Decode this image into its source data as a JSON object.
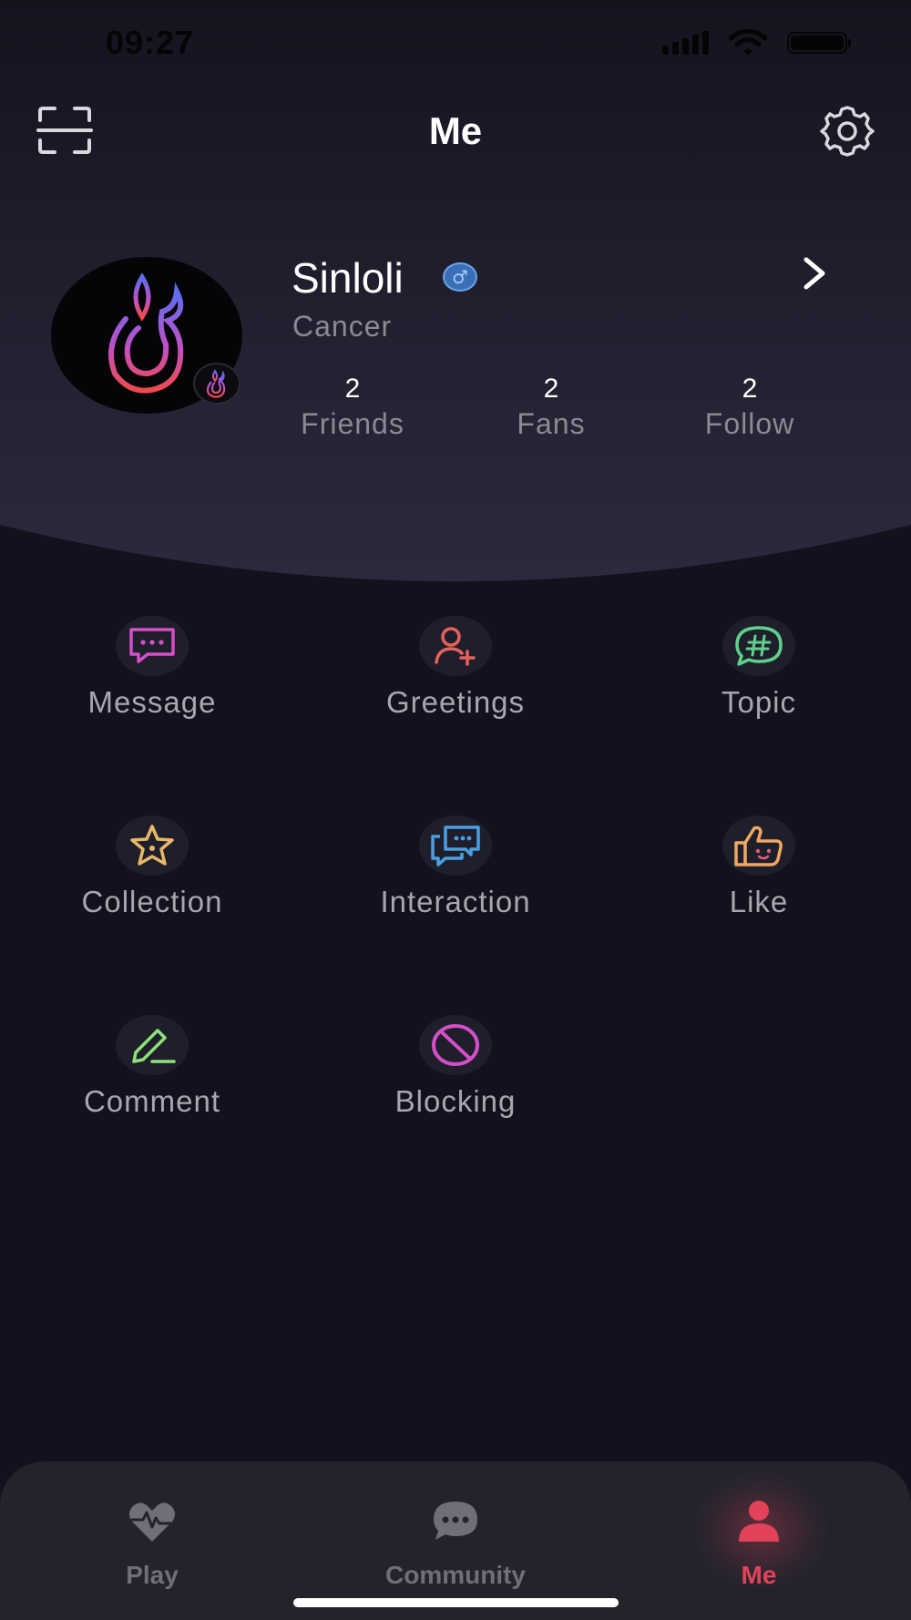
{
  "status_bar": {
    "time": "09:27"
  },
  "header": {
    "title": "Me"
  },
  "profile": {
    "username": "Sinloli",
    "gender_symbol": "♂",
    "zodiac": "Cancer",
    "stats": [
      {
        "value": "2",
        "label": "Friends"
      },
      {
        "value": "2",
        "label": "Fans"
      },
      {
        "value": "2",
        "label": "Follow"
      }
    ]
  },
  "menu": [
    {
      "label": "Message",
      "icon": "message-icon",
      "color": "#d44fc8"
    },
    {
      "label": "Greetings",
      "icon": "add-person-icon",
      "color": "#e8605a"
    },
    {
      "label": "Topic",
      "icon": "hashtag-chat-icon",
      "color": "#5fd08a"
    },
    {
      "label": "Collection",
      "icon": "star-icon",
      "color": "#e8b86a"
    },
    {
      "label": "Interaction",
      "icon": "chat-bubbles-icon",
      "color": "#4a9fe0"
    },
    {
      "label": "Like",
      "icon": "thumbs-up-icon",
      "color": "#f0a860"
    },
    {
      "label": "Comment",
      "icon": "pencil-icon",
      "color": "#8ee07a"
    },
    {
      "label": "Blocking",
      "icon": "block-icon",
      "color": "#d44fc8"
    }
  ],
  "tabbar": {
    "active": "Me",
    "accent": "#e2425a",
    "inactive_color": "#6f6f7a",
    "tabs": [
      {
        "label": "Play",
        "icon": "heart-pulse-icon"
      },
      {
        "label": "Community",
        "icon": "chat-dots-icon"
      },
      {
        "label": "Me",
        "icon": "person-icon"
      }
    ]
  }
}
